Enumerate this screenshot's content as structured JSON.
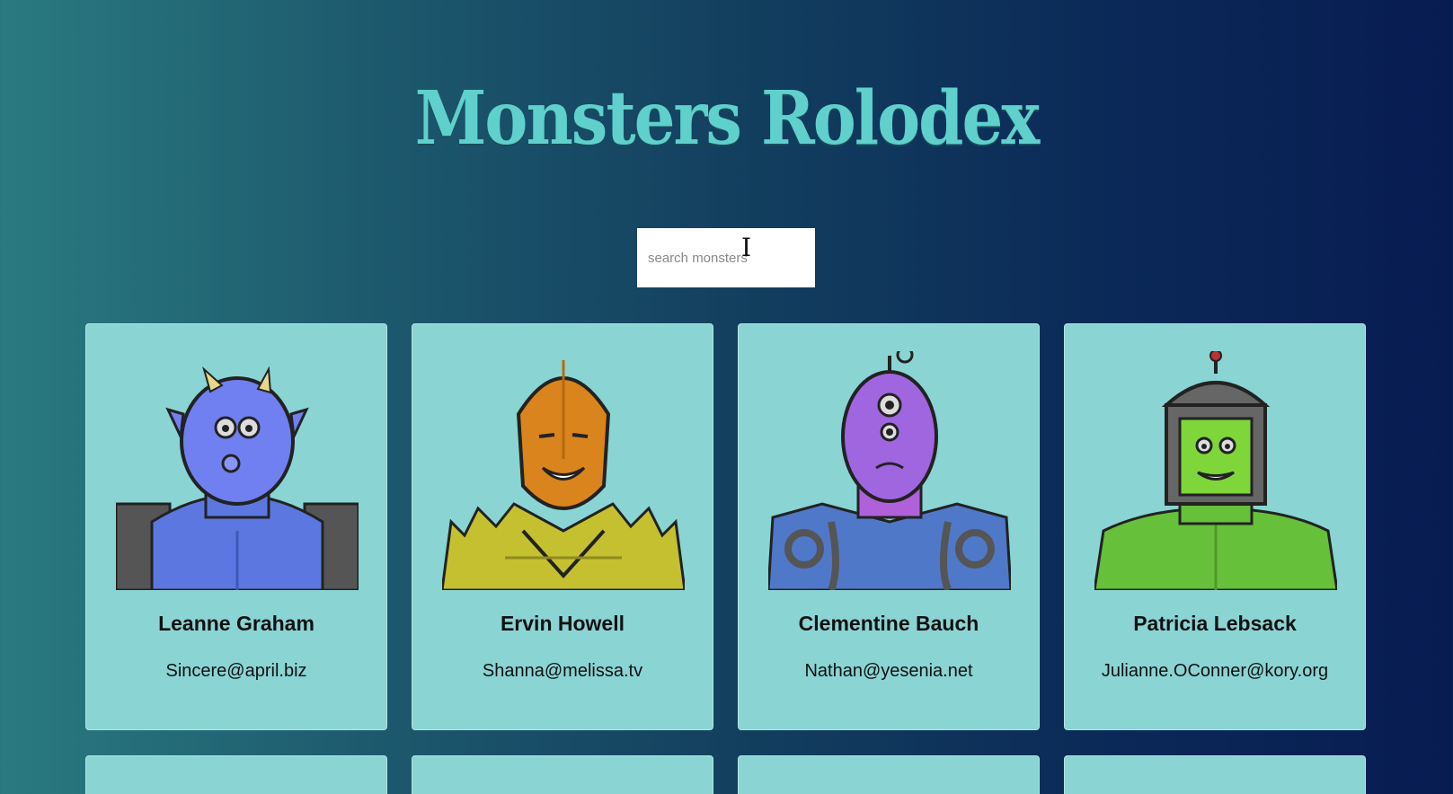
{
  "header": {
    "title": "Monsters Rolodex"
  },
  "search": {
    "placeholder": "search monsters"
  },
  "monsters": [
    {
      "name": "Leanne Graham",
      "email": "Sincere@april.biz",
      "icon": "blue-horned-monster-portrait"
    },
    {
      "name": "Ervin Howell",
      "email": "Shanna@melissa.tv",
      "icon": "orange-spiky-monster-portrait"
    },
    {
      "name": "Clementine Bauch",
      "email": "Nathan@yesenia.net",
      "icon": "purple-cyclops-monster-portrait"
    },
    {
      "name": "Patricia Lebsack",
      "email": "Julianne.OConner@kory.org",
      "icon": "green-robot-monster-portrait"
    }
  ],
  "colors": {
    "card": "#8ad4d4",
    "title": "#5fd0cc",
    "background_start": "#2a7a80",
    "background_end": "#081c52"
  }
}
